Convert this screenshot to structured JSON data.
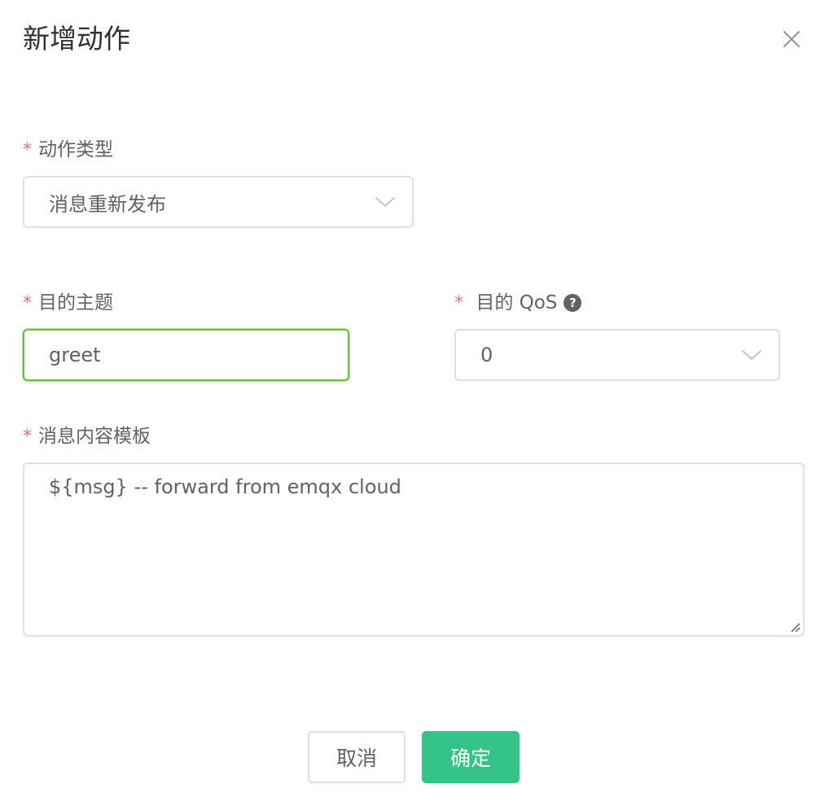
{
  "dialog": {
    "title": "新增动作",
    "close_icon": "close-icon"
  },
  "form": {
    "action_type": {
      "required_mark": "*",
      "label": "动作类型",
      "value": "消息重新发布",
      "icon": "chevron-down-icon"
    },
    "target_topic": {
      "required_mark": "*",
      "label": "目的主题",
      "value": "greet",
      "focused": true
    },
    "target_qos": {
      "required_mark": "*",
      "label": "目的 QoS",
      "help_icon": "question-circle-icon",
      "help_glyph": "?",
      "value": "0",
      "icon": "chevron-down-icon"
    },
    "payload_template": {
      "required_mark": "*",
      "label": "消息内容模板",
      "value": "${msg} -- forward from emqx cloud"
    }
  },
  "footer": {
    "cancel_label": "取消",
    "confirm_label": "确定"
  },
  "colors": {
    "required": "#f56c6c",
    "focus_border": "#67c23a",
    "primary_button": "#34c388",
    "border": "#dcdfe6",
    "text": "#606266",
    "title": "#303133"
  }
}
